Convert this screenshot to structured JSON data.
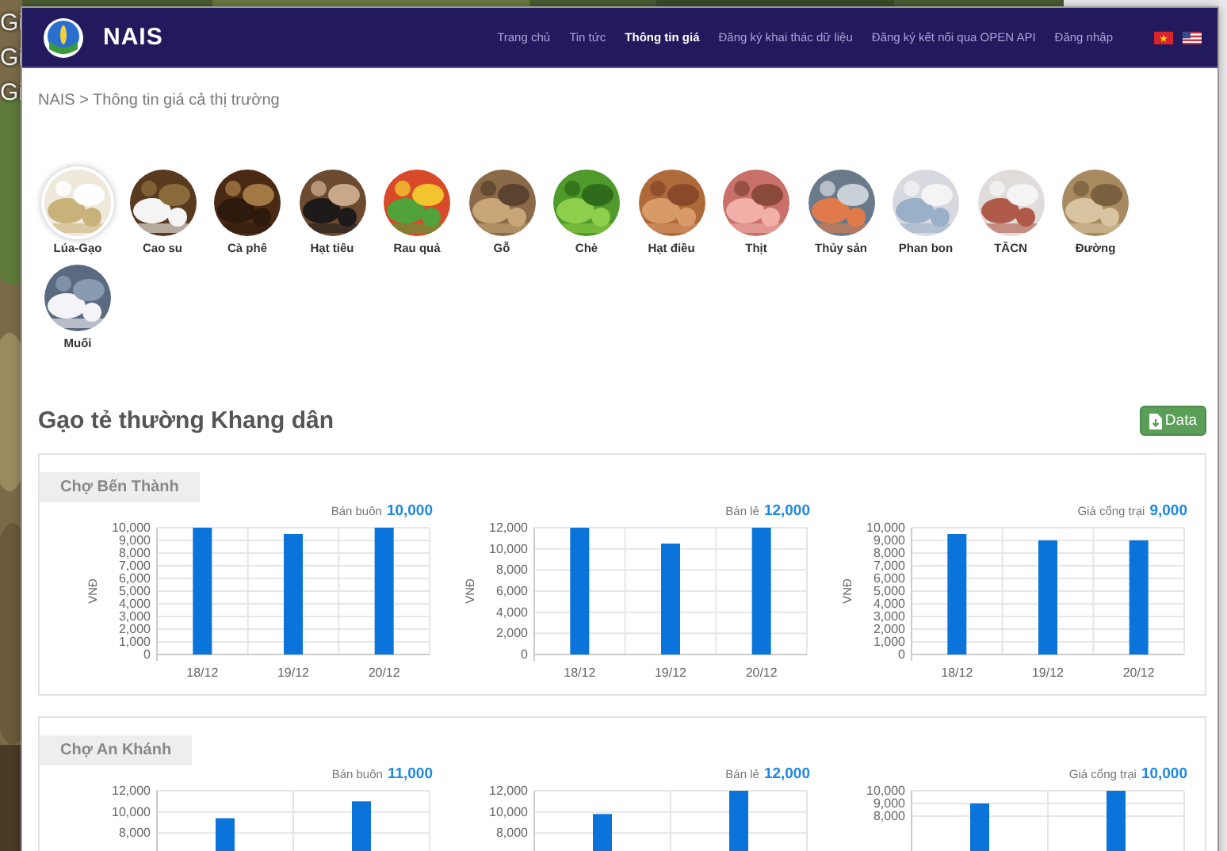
{
  "backdrop": {
    "texts": [
      "Gi",
      "Gi",
      "Gi"
    ]
  },
  "navbar": {
    "brand": "NAIS",
    "links": [
      {
        "label": "Trang chủ",
        "selected": false
      },
      {
        "label": "Tin tức",
        "selected": false
      },
      {
        "label": "Thông tin giá",
        "selected": true
      },
      {
        "label": "Đăng ký khai thác dữ liệu",
        "selected": false
      },
      {
        "label": "Đăng ký kết nối qua OPEN API",
        "selected": false
      },
      {
        "label": "Đăng nhập",
        "selected": false
      }
    ],
    "languages": [
      {
        "kind": "vn"
      },
      {
        "kind": "us"
      }
    ]
  },
  "breadcrumb": "NAIS > Thông tin giá cả thị trường",
  "categories": [
    {
      "label": "Lúa-Gạo",
      "selected": true
    },
    {
      "label": "Cao su",
      "selected": false
    },
    {
      "label": "Cà phê",
      "selected": false
    },
    {
      "label": "Hạt tiêu",
      "selected": false
    },
    {
      "label": "Rau quả",
      "selected": false
    },
    {
      "label": "Gỗ",
      "selected": false
    },
    {
      "label": "Chè",
      "selected": false
    },
    {
      "label": "Hạt điều",
      "selected": false
    },
    {
      "label": "Thịt",
      "selected": false
    },
    {
      "label": "Thủy sản",
      "selected": false
    },
    {
      "label": "Phan bon",
      "selected": false
    },
    {
      "label": "TĂCN",
      "selected": false
    },
    {
      "label": "Đường",
      "selected": false
    },
    {
      "label": "Muối",
      "selected": false
    }
  ],
  "product": {
    "title": "Gạo tẻ thường Khang dân",
    "button": "Data"
  },
  "markets": [
    {
      "name": "Chợ Bến Thành",
      "prices": [
        {
          "label": "Bán buôn",
          "value": "10,000",
          "chart_data": {
            "type": "bar",
            "grid": true,
            "ylabel": "VNĐ",
            "categories": [
              "18/12",
              "19/12",
              "20/12"
            ],
            "values": [
              10000,
              9500,
              10000
            ],
            "ylim": [
              0,
              10000
            ],
            "yticks": [
              {
                "value": 0,
                "label": "0"
              },
              {
                "value": 1000,
                "label": "1,000"
              },
              {
                "value": 2000,
                "label": "2,000"
              },
              {
                "value": 3000,
                "label": "3,000"
              },
              {
                "value": 4000,
                "label": "4,000"
              },
              {
                "value": 5000,
                "label": "5,000"
              },
              {
                "value": 6000,
                "label": "6,000"
              },
              {
                "value": 7000,
                "label": "7,000"
              },
              {
                "value": 8000,
                "label": "8,000"
              },
              {
                "value": 9000,
                "label": "9,000"
              },
              {
                "value": 10000,
                "label": "10,000"
              }
            ]
          }
        },
        {
          "label": "Bán lẻ",
          "value": "12,000",
          "chart_data": {
            "type": "bar",
            "grid": true,
            "ylabel": "VNĐ",
            "categories": [
              "18/12",
              "19/12",
              "20/12"
            ],
            "values": [
              12000,
              10500,
              12000
            ],
            "ylim": [
              0,
              12000
            ],
            "yticks": [
              {
                "value": 0,
                "label": "0"
              },
              {
                "value": 2000,
                "label": "2,000"
              },
              {
                "value": 4000,
                "label": "4,000"
              },
              {
                "value": 6000,
                "label": "6,000"
              },
              {
                "value": 8000,
                "label": "8,000"
              },
              {
                "value": 10000,
                "label": "10,000"
              },
              {
                "value": 12000,
                "label": "12,000"
              }
            ]
          }
        },
        {
          "label": "Giá cổng trại",
          "value": "9,000",
          "chart_data": {
            "type": "bar",
            "grid": true,
            "ylabel": "VNĐ",
            "categories": [
              "18/12",
              "19/12",
              "20/12"
            ],
            "values": [
              9500,
              9000,
              9000
            ],
            "ylim": [
              0,
              10000
            ],
            "yticks": [
              {
                "value": 0,
                "label": "0"
              },
              {
                "value": 1000,
                "label": "1,000"
              },
              {
                "value": 2000,
                "label": "2,000"
              },
              {
                "value": 3000,
                "label": "3,000"
              },
              {
                "value": 4000,
                "label": "4,000"
              },
              {
                "value": 5000,
                "label": "5,000"
              },
              {
                "value": 6000,
                "label": "6,000"
              },
              {
                "value": 7000,
                "label": "7,000"
              },
              {
                "value": 8000,
                "label": "8,000"
              },
              {
                "value": 9000,
                "label": "9,000"
              },
              {
                "value": 10000,
                "label": "10,000"
              }
            ]
          }
        }
      ]
    },
    {
      "name": "Chợ An Khánh",
      "prices": [
        {
          "label": "Bán buôn",
          "value": "11,000",
          "chart_data": {
            "type": "bar",
            "grid": true,
            "categories": [
              null,
              null
            ],
            "values": [
              9400,
              11000
            ],
            "ylim": [
              0,
              12000
            ],
            "yticks": [
              {
                "value": 8000,
                "label": "8,000"
              },
              {
                "value": 10000,
                "label": "10,000"
              },
              {
                "value": 12000,
                "label": "12,000"
              }
            ]
          }
        },
        {
          "label": "Bán lẻ",
          "value": "12,000",
          "chart_data": {
            "type": "bar",
            "grid": true,
            "categories": [
              null,
              null
            ],
            "values": [
              9800,
              12000
            ],
            "ylim": [
              0,
              12000
            ],
            "yticks": [
              {
                "value": 8000,
                "label": "8,000"
              },
              {
                "value": 10000,
                "label": "10,000"
              },
              {
                "value": 12000,
                "label": "12,000"
              }
            ]
          }
        },
        {
          "label": "Giá cổng trại",
          "value": "10,000",
          "chart_data": {
            "type": "bar",
            "grid": true,
            "categories": [
              null,
              null
            ],
            "values": [
              9000,
              10000
            ],
            "ylim": [
              0,
              10000
            ],
            "yticks": [
              {
                "value": 8000,
                "label": "8,000"
              },
              {
                "value": 9000,
                "label": "9,000"
              },
              {
                "value": 10000,
                "label": "10,000"
              }
            ]
          }
        }
      ]
    }
  ]
}
